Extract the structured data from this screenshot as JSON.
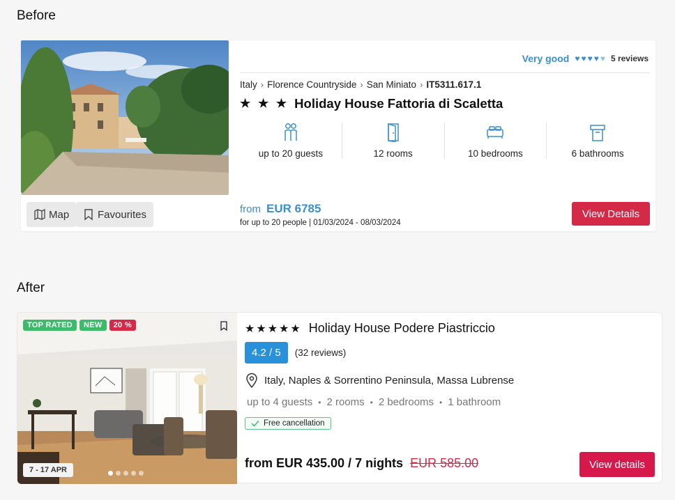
{
  "before": {
    "section_title": "Before",
    "rating_label": "Very good",
    "reviews": "5 reviews",
    "hearts_icon": "heart-icon",
    "breadcrumb": [
      "Italy",
      "Florence Countryside",
      "San Miniato"
    ],
    "reference": "IT5311.617.1",
    "stars": "★ ★ ★",
    "title": "Holiday House Fattoria di Scaletta",
    "features": {
      "guests": "up to 20 guests",
      "rooms": "12 rooms",
      "bedrooms": "10 bedrooms",
      "bathrooms": "6 bathrooms"
    },
    "map_label": "Map",
    "favourites_label": "Favourites",
    "price_from": "from",
    "price": "EUR 6785",
    "price_sub": "for up to 20 people | 01/03/2024 - 08/03/2024",
    "details_button": "View Details",
    "accent": "#3a8fcf",
    "button_color": "#d42947"
  },
  "after": {
    "section_title": "After",
    "badges": [
      "TOP RATED",
      "NEW",
      "20 %"
    ],
    "date_range": "7 - 17 APR",
    "stars": "★★★★★",
    "title": "Holiday House Podere Piastriccio",
    "score": "4.2 / 5",
    "reviews": "(32 reviews)",
    "location": "Italy, Naples & Sorrentino Peninsula, Massa Lubrense",
    "facts": [
      "up to 4 guests",
      "2 rooms",
      "2 bedrooms",
      "1 bathroom"
    ],
    "free_cancellation": "Free cancellation",
    "price": "from EUR 435.00 / 7 nights",
    "old_price": "EUR 585.00",
    "details_button": "View details",
    "score_color": "#2891d9",
    "button_color": "#d6194a"
  }
}
